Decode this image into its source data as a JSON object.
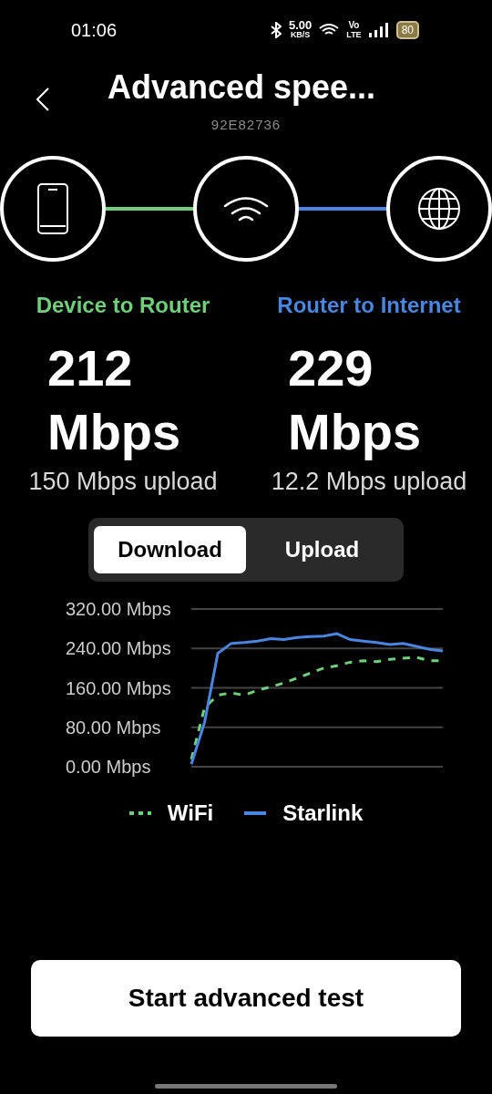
{
  "status_bar": {
    "time": "01:06",
    "net_speed": "5.00",
    "net_unit": "KB/S",
    "volte_top": "Vo",
    "volte_bottom": "LTE",
    "battery": "80"
  },
  "header": {
    "title": "Advanced spee...",
    "subtitle": "92E82736"
  },
  "path": {
    "nodes": [
      {
        "kind": "phone"
      },
      {
        "kind": "wifi"
      },
      {
        "kind": "globe"
      }
    ],
    "links": [
      {
        "color": "#6fcf7a"
      },
      {
        "color": "#4a86e0"
      }
    ]
  },
  "results": [
    {
      "label": "Device to Router",
      "color": "#6fcf7a",
      "value": "212",
      "unit": "Mbps",
      "upload": "150 Mbps upload"
    },
    {
      "label": "Router to Internet",
      "color": "#4a86e0",
      "value": "229",
      "unit": "Mbps",
      "upload": "12.2 Mbps upload"
    }
  ],
  "tabs": [
    {
      "label": "Download",
      "selected": true
    },
    {
      "label": "Upload",
      "selected": false
    }
  ],
  "chart_data": {
    "type": "line",
    "grid": true,
    "ylim": [
      0,
      320
    ],
    "yticks": [
      {
        "value": 0,
        "label": "0.00 Mbps"
      },
      {
        "value": 80,
        "label": "80.00 Mbps"
      },
      {
        "value": 160,
        "label": "160.00 Mbps"
      },
      {
        "value": 240,
        "label": "240.00 Mbps"
      },
      {
        "value": 320,
        "label": "320.00 Mbps"
      }
    ],
    "series": [
      {
        "name": "WiFi",
        "color": "#6fcf7a",
        "line_style": "dashed",
        "values": [
          15,
          120,
          145,
          150,
          145,
          155,
          162,
          170,
          180,
          190,
          200,
          205,
          212,
          215,
          213,
          218,
          220,
          222,
          215,
          215
        ]
      },
      {
        "name": "Starlink",
        "color": "#4a86e0",
        "line_style": "solid",
        "values": [
          5,
          90,
          230,
          250,
          252,
          255,
          260,
          258,
          262,
          264,
          265,
          270,
          258,
          255,
          252,
          248,
          250,
          244,
          238,
          235
        ]
      }
    ]
  },
  "start_button": "Start advanced test"
}
